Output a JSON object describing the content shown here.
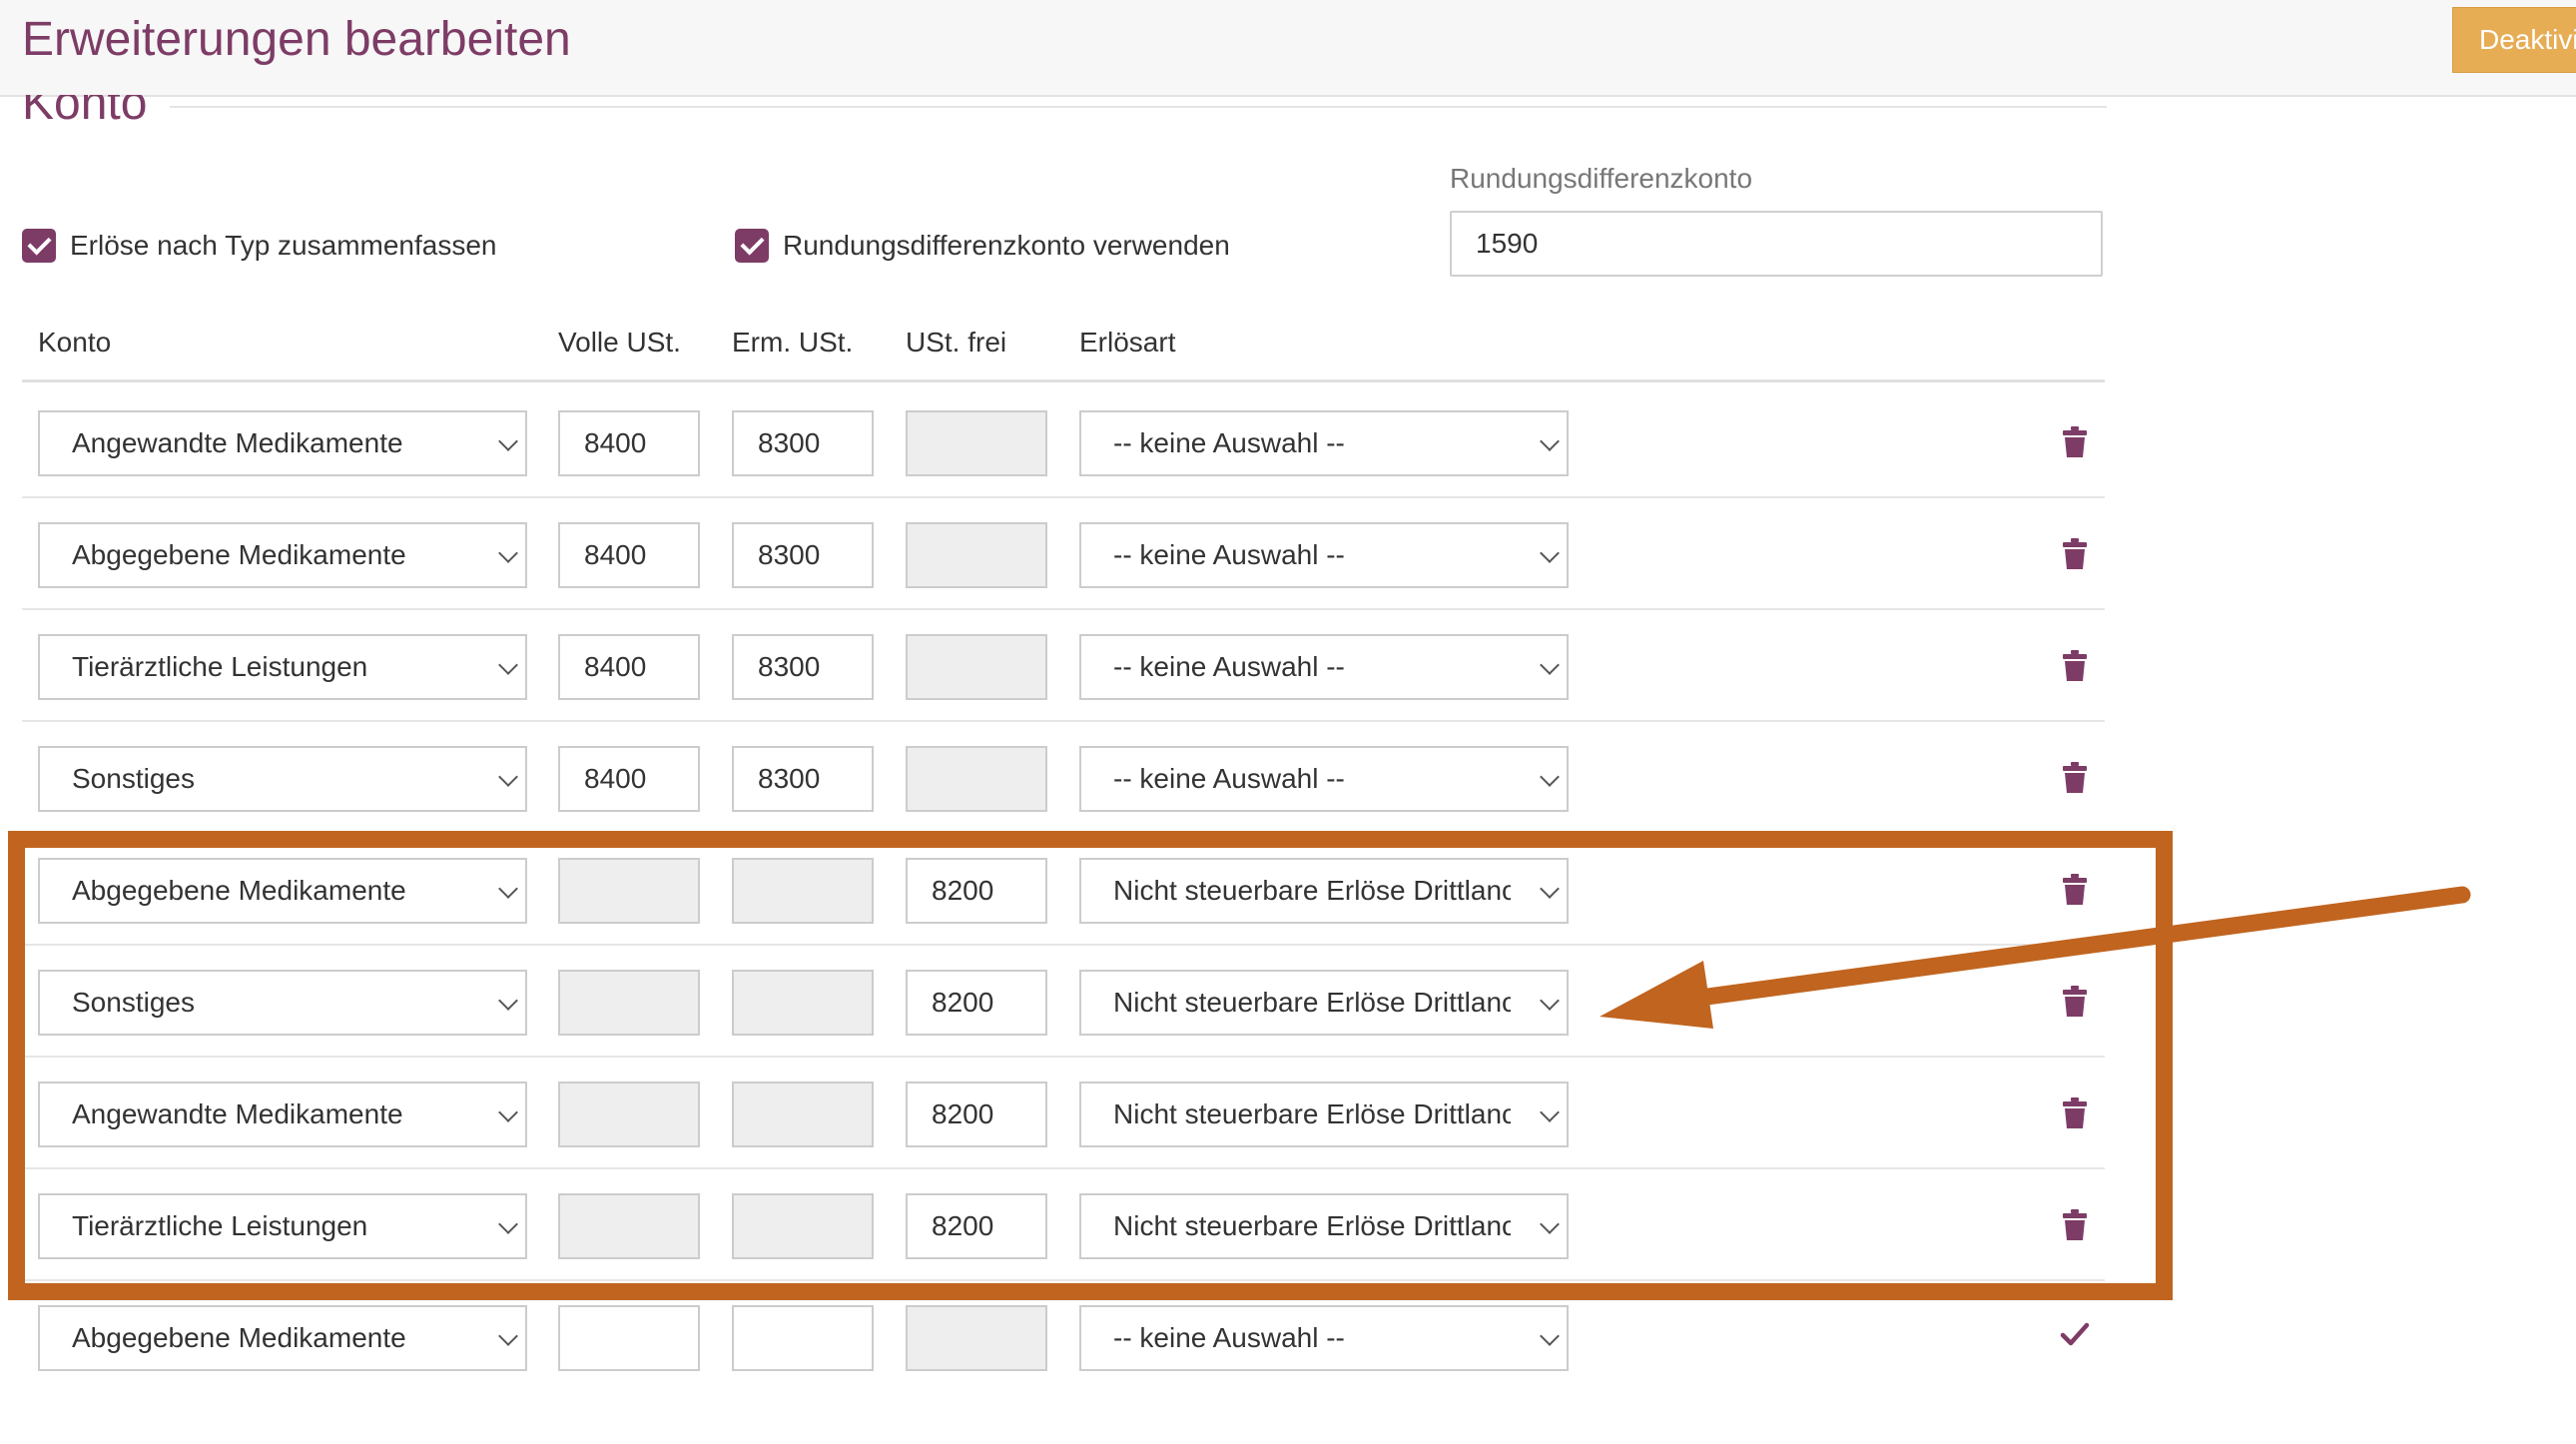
{
  "header": {
    "title": "Erweiterungen bearbeiten",
    "deactivate_label": "Deaktivi"
  },
  "section": {
    "title": "Konto"
  },
  "options": {
    "merge_label": "Erlöse nach Typ zusammenfassen",
    "merge_checked": true,
    "rounding_label": "Rundungsdifferenzkonto verwenden",
    "rounding_checked": true,
    "rounding_account_label": "Rundungsdifferenzkonto",
    "rounding_account_value": "1590"
  },
  "table": {
    "headers": {
      "konto": "Konto",
      "volle": "Volle USt.",
      "erm": "Erm. USt.",
      "frei": "USt. frei",
      "erloesart": "Erlösart"
    },
    "rows": [
      {
        "konto": "Angewandte Medikamente",
        "volle": "8400",
        "erm": "8300",
        "frei": "",
        "erloesart": "-- keine Auswahl --"
      },
      {
        "konto": "Abgegebene Medikamente",
        "volle": "8400",
        "erm": "8300",
        "frei": "",
        "erloesart": "-- keine Auswahl --"
      },
      {
        "konto": "Tierärztliche Leistungen",
        "volle": "8400",
        "erm": "8300",
        "frei": "",
        "erloesart": "-- keine Auswahl --"
      },
      {
        "konto": "Sonstiges",
        "volle": "8400",
        "erm": "8300",
        "frei": "",
        "erloesart": "-- keine Auswahl --"
      },
      {
        "konto": "Abgegebene Medikamente",
        "volle": "",
        "erm": "",
        "frei": "8200",
        "erloesart": "Nicht steuerbare Erlöse Drittlanc"
      },
      {
        "konto": "Sonstiges",
        "volle": "",
        "erm": "",
        "frei": "8200",
        "erloesart": "Nicht steuerbare Erlöse Drittlanc"
      },
      {
        "konto": "Angewandte Medikamente",
        "volle": "",
        "erm": "",
        "frei": "8200",
        "erloesart": "Nicht steuerbare Erlöse Drittlanc"
      },
      {
        "konto": "Tierärztliche Leistungen",
        "volle": "",
        "erm": "",
        "frei": "8200",
        "erloesart": "Nicht steuerbare Erlöse Drittlanc"
      }
    ],
    "new_row": {
      "konto": "Abgegebene Medikamente",
      "volle": "",
      "erm": "",
      "frei": "",
      "erloesart": "-- keine Auswahl --"
    }
  },
  "colors": {
    "brand": "#7d3c66",
    "accent": "#e6ad55",
    "highlight": "#c0641f"
  },
  "icons": {
    "row_action": "trash-icon",
    "confirm": "checkmark-icon",
    "dropdown": "chevron-down-icon"
  }
}
